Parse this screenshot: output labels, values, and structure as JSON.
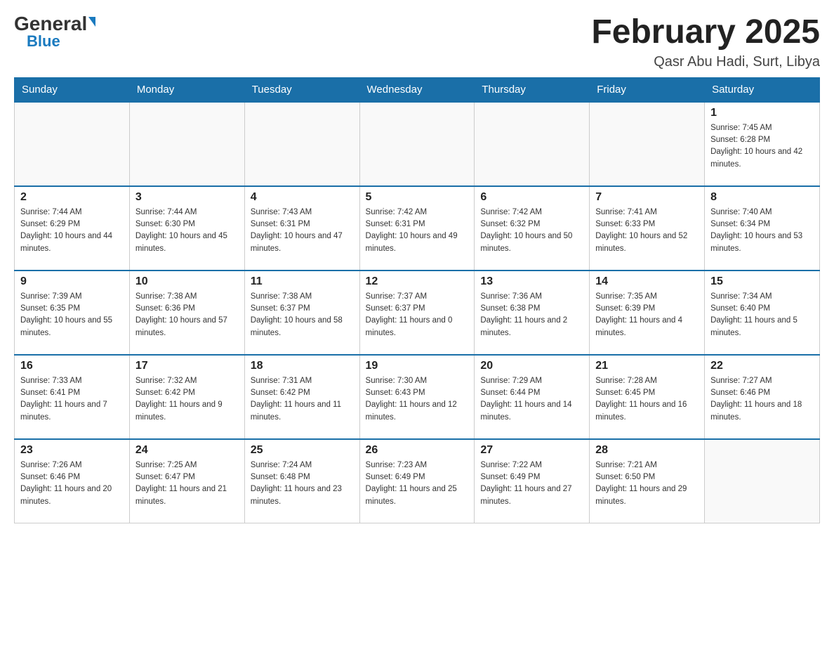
{
  "header": {
    "logo_general": "General",
    "logo_blue": "Blue",
    "month_title": "February 2025",
    "location": "Qasr Abu Hadi, Surt, Libya"
  },
  "weekdays": [
    "Sunday",
    "Monday",
    "Tuesday",
    "Wednesday",
    "Thursday",
    "Friday",
    "Saturday"
  ],
  "weeks": [
    [
      {
        "day": "",
        "sunrise": "",
        "sunset": "",
        "daylight": ""
      },
      {
        "day": "",
        "sunrise": "",
        "sunset": "",
        "daylight": ""
      },
      {
        "day": "",
        "sunrise": "",
        "sunset": "",
        "daylight": ""
      },
      {
        "day": "",
        "sunrise": "",
        "sunset": "",
        "daylight": ""
      },
      {
        "day": "",
        "sunrise": "",
        "sunset": "",
        "daylight": ""
      },
      {
        "day": "",
        "sunrise": "",
        "sunset": "",
        "daylight": ""
      },
      {
        "day": "1",
        "sunrise": "Sunrise: 7:45 AM",
        "sunset": "Sunset: 6:28 PM",
        "daylight": "Daylight: 10 hours and 42 minutes."
      }
    ],
    [
      {
        "day": "2",
        "sunrise": "Sunrise: 7:44 AM",
        "sunset": "Sunset: 6:29 PM",
        "daylight": "Daylight: 10 hours and 44 minutes."
      },
      {
        "day": "3",
        "sunrise": "Sunrise: 7:44 AM",
        "sunset": "Sunset: 6:30 PM",
        "daylight": "Daylight: 10 hours and 45 minutes."
      },
      {
        "day": "4",
        "sunrise": "Sunrise: 7:43 AM",
        "sunset": "Sunset: 6:31 PM",
        "daylight": "Daylight: 10 hours and 47 minutes."
      },
      {
        "day": "5",
        "sunrise": "Sunrise: 7:42 AM",
        "sunset": "Sunset: 6:31 PM",
        "daylight": "Daylight: 10 hours and 49 minutes."
      },
      {
        "day": "6",
        "sunrise": "Sunrise: 7:42 AM",
        "sunset": "Sunset: 6:32 PM",
        "daylight": "Daylight: 10 hours and 50 minutes."
      },
      {
        "day": "7",
        "sunrise": "Sunrise: 7:41 AM",
        "sunset": "Sunset: 6:33 PM",
        "daylight": "Daylight: 10 hours and 52 minutes."
      },
      {
        "day": "8",
        "sunrise": "Sunrise: 7:40 AM",
        "sunset": "Sunset: 6:34 PM",
        "daylight": "Daylight: 10 hours and 53 minutes."
      }
    ],
    [
      {
        "day": "9",
        "sunrise": "Sunrise: 7:39 AM",
        "sunset": "Sunset: 6:35 PM",
        "daylight": "Daylight: 10 hours and 55 minutes."
      },
      {
        "day": "10",
        "sunrise": "Sunrise: 7:38 AM",
        "sunset": "Sunset: 6:36 PM",
        "daylight": "Daylight: 10 hours and 57 minutes."
      },
      {
        "day": "11",
        "sunrise": "Sunrise: 7:38 AM",
        "sunset": "Sunset: 6:37 PM",
        "daylight": "Daylight: 10 hours and 58 minutes."
      },
      {
        "day": "12",
        "sunrise": "Sunrise: 7:37 AM",
        "sunset": "Sunset: 6:37 PM",
        "daylight": "Daylight: 11 hours and 0 minutes."
      },
      {
        "day": "13",
        "sunrise": "Sunrise: 7:36 AM",
        "sunset": "Sunset: 6:38 PM",
        "daylight": "Daylight: 11 hours and 2 minutes."
      },
      {
        "day": "14",
        "sunrise": "Sunrise: 7:35 AM",
        "sunset": "Sunset: 6:39 PM",
        "daylight": "Daylight: 11 hours and 4 minutes."
      },
      {
        "day": "15",
        "sunrise": "Sunrise: 7:34 AM",
        "sunset": "Sunset: 6:40 PM",
        "daylight": "Daylight: 11 hours and 5 minutes."
      }
    ],
    [
      {
        "day": "16",
        "sunrise": "Sunrise: 7:33 AM",
        "sunset": "Sunset: 6:41 PM",
        "daylight": "Daylight: 11 hours and 7 minutes."
      },
      {
        "day": "17",
        "sunrise": "Sunrise: 7:32 AM",
        "sunset": "Sunset: 6:42 PM",
        "daylight": "Daylight: 11 hours and 9 minutes."
      },
      {
        "day": "18",
        "sunrise": "Sunrise: 7:31 AM",
        "sunset": "Sunset: 6:42 PM",
        "daylight": "Daylight: 11 hours and 11 minutes."
      },
      {
        "day": "19",
        "sunrise": "Sunrise: 7:30 AM",
        "sunset": "Sunset: 6:43 PM",
        "daylight": "Daylight: 11 hours and 12 minutes."
      },
      {
        "day": "20",
        "sunrise": "Sunrise: 7:29 AM",
        "sunset": "Sunset: 6:44 PM",
        "daylight": "Daylight: 11 hours and 14 minutes."
      },
      {
        "day": "21",
        "sunrise": "Sunrise: 7:28 AM",
        "sunset": "Sunset: 6:45 PM",
        "daylight": "Daylight: 11 hours and 16 minutes."
      },
      {
        "day": "22",
        "sunrise": "Sunrise: 7:27 AM",
        "sunset": "Sunset: 6:46 PM",
        "daylight": "Daylight: 11 hours and 18 minutes."
      }
    ],
    [
      {
        "day": "23",
        "sunrise": "Sunrise: 7:26 AM",
        "sunset": "Sunset: 6:46 PM",
        "daylight": "Daylight: 11 hours and 20 minutes."
      },
      {
        "day": "24",
        "sunrise": "Sunrise: 7:25 AM",
        "sunset": "Sunset: 6:47 PM",
        "daylight": "Daylight: 11 hours and 21 minutes."
      },
      {
        "day": "25",
        "sunrise": "Sunrise: 7:24 AM",
        "sunset": "Sunset: 6:48 PM",
        "daylight": "Daylight: 11 hours and 23 minutes."
      },
      {
        "day": "26",
        "sunrise": "Sunrise: 7:23 AM",
        "sunset": "Sunset: 6:49 PM",
        "daylight": "Daylight: 11 hours and 25 minutes."
      },
      {
        "day": "27",
        "sunrise": "Sunrise: 7:22 AM",
        "sunset": "Sunset: 6:49 PM",
        "daylight": "Daylight: 11 hours and 27 minutes."
      },
      {
        "day": "28",
        "sunrise": "Sunrise: 7:21 AM",
        "sunset": "Sunset: 6:50 PM",
        "daylight": "Daylight: 11 hours and 29 minutes."
      },
      {
        "day": "",
        "sunrise": "",
        "sunset": "",
        "daylight": ""
      }
    ]
  ]
}
